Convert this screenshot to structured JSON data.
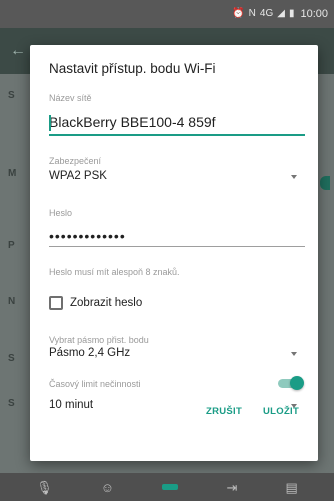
{
  "status_bar": {
    "time": "10:00",
    "network_label": "4G",
    "icons": [
      "alarm-icon",
      "nfc-icon",
      "signal-icon",
      "battery-icon"
    ]
  },
  "background": {
    "rows": [
      "S",
      "M",
      "P",
      "N",
      "S",
      "S"
    ]
  },
  "dialog": {
    "title": "Nastavit přístup. bodu Wi-Fi",
    "network_name_label": "Název sítě",
    "network_name_value": "BlackBerry BBE100-4 859f",
    "security_label": "Zabezpečení",
    "security_value": "WPA2 PSK",
    "password_label": "Heslo",
    "password_value": "•••••••••••••",
    "password_hint": "Heslo musí mít alespoň 8 znaků.",
    "show_password_label": "Zobrazit heslo",
    "show_password_checked": false,
    "band_label": "Vybrat pásmo přist. bodu",
    "band_value": "Pásmo 2,4 GHz",
    "timeout_label": "Časový limit nečinnosti",
    "timeout_enabled": true,
    "timeout_value": "10 minut",
    "cancel_label": "ZRUŠIT",
    "save_label": "ULOŽIT"
  },
  "colors": {
    "accent": "#1a9c86"
  },
  "bottom_bar": {
    "icons": [
      "microphone-icon",
      "emoji-icon",
      "keyboard-icon",
      "text-shortcut-icon",
      "clipboard-icon"
    ]
  }
}
